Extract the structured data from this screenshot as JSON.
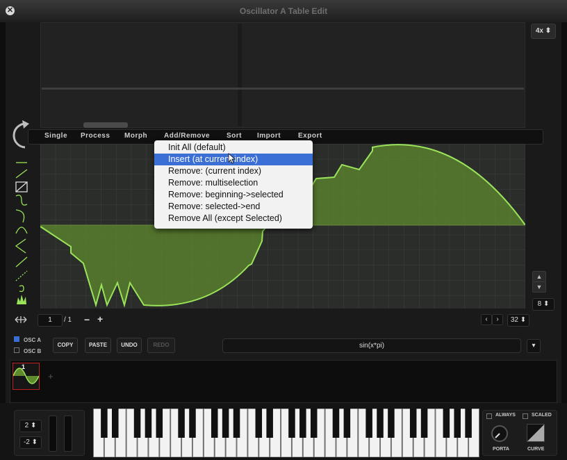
{
  "window": {
    "title": "Oscillator A Table Edit",
    "close_label": "✕"
  },
  "zoom": {
    "label": "4x ⬍"
  },
  "menu": {
    "tabs": [
      {
        "label": "Single"
      },
      {
        "label": "Process"
      },
      {
        "label": "Morph"
      },
      {
        "label": "Add/Remove"
      },
      {
        "label": "Sort"
      },
      {
        "label": "Import"
      },
      {
        "label": "Export"
      }
    ]
  },
  "dropdown": {
    "items": [
      {
        "label": "Init All (default)",
        "selected": false
      },
      {
        "label": "Insert (at current index)",
        "selected": true
      },
      {
        "label": "Remove: (current index)",
        "selected": false
      },
      {
        "label": "Remove: multiselection",
        "selected": false
      },
      {
        "label": "Remove: beginning->selected",
        "selected": false
      },
      {
        "label": "Remove: selected->end",
        "selected": false
      },
      {
        "label": "Remove All (except Selected)",
        "selected": false
      }
    ]
  },
  "nav": {
    "frame_value": "1",
    "frame_total": "/ 1",
    "minus": "−",
    "plus": "+",
    "grid_value": "32 ⬍",
    "side_value": "8 ⬍"
  },
  "osc": {
    "a_label": "OSC A",
    "b_label": "OSC B"
  },
  "buttons": {
    "copy": "COPY",
    "paste": "PASTE",
    "undo": "UNDO",
    "redo": "REDO"
  },
  "formula": {
    "value": "sin(x*pi)"
  },
  "strip": {
    "thumb_index": "1",
    "add_label": "+"
  },
  "keyboard": {
    "pitch_up": "2 ⬍",
    "pitch_down": "-2 ⬍",
    "always_label": "ALWAYS",
    "scaled_label": "SCALED",
    "porta_label": "PORTA",
    "curve_label": "CURVE"
  },
  "colors": {
    "wave_line": "#9be45a",
    "wave_fill": "#5f8a2e",
    "selection": "#3b6fd6"
  },
  "icons": {
    "rotate": "rotate-icon",
    "close": "close-icon",
    "move": "move-arrows-icon"
  }
}
